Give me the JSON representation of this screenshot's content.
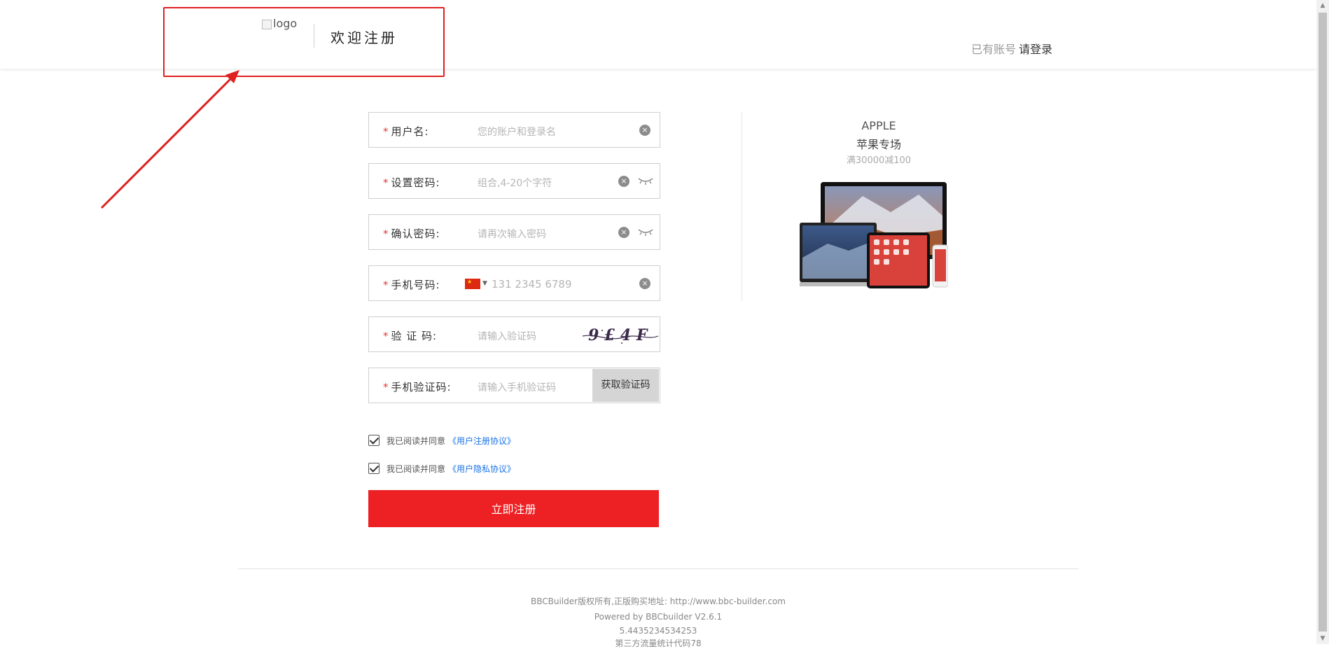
{
  "header": {
    "logo_alt": "logo",
    "welcome": "欢迎注册",
    "login_prompt": "已有账号",
    "login_link": "请登录"
  },
  "form": {
    "fields": [
      {
        "label": "用户名:",
        "placeholder": "您的账户和登录名"
      },
      {
        "label": "设置密码:",
        "placeholder": "组合,4-20个字符"
      },
      {
        "label": "确认密码:",
        "placeholder": "请再次输入密码"
      },
      {
        "label": "手机号码:",
        "placeholder": "131 2345 6789"
      },
      {
        "label": "验 证 码:",
        "placeholder": "请输入验证码"
      },
      {
        "label": "手机验证码:",
        "placeholder": "请输入手机验证码"
      }
    ],
    "required_mark": "*",
    "captcha_text": "9 £ 4 F",
    "sms_button": "获取验证码",
    "agreements": [
      {
        "text": "我已阅读并同意",
        "link": "《用户注册协议》",
        "checked": true
      },
      {
        "text": "我已阅读并同意",
        "link": "《用户隐私协议》",
        "checked": true
      }
    ],
    "submit": "立即注册"
  },
  "promo": {
    "brand": "APPLE",
    "title": "苹果专场",
    "subtitle": "满30000减100"
  },
  "footer": {
    "copyright": "BBCBuilder版权所有,正版购买地址: http://www.bbc-builder.com",
    "powered": "Powered by BBCbuilder V2.6.1",
    "version": "5.4435234534253",
    "stats": "第三方流量统计代码78"
  },
  "colors": {
    "accent": "#ed2024",
    "link": "#1a73e8",
    "annotation": "#e02020"
  }
}
